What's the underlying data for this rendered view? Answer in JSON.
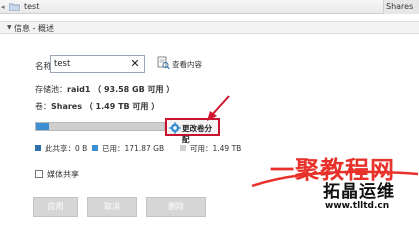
{
  "topbar": {
    "title": "test",
    "right_tab": "Shares",
    "icon": "folder-icon"
  },
  "section": {
    "label": "信息 - 概述"
  },
  "name": {
    "label": "名称：",
    "value": "test",
    "clear_icon": "close-icon",
    "view_link": "查看内容",
    "view_icon": "document-icon"
  },
  "pool": {
    "label": "存储池：",
    "value": "raid1 （ 93.58 GB 可用 ）"
  },
  "volume": {
    "label": "卷：",
    "value": "Shares （ 1.49 TB 可用 ）"
  },
  "usage": {
    "used_fraction": 0.1,
    "bar_color": "#3d8fd3"
  },
  "change_volume": {
    "label": "更改卷分配",
    "icon": "gear-icon",
    "highlight_color": "#c8132e"
  },
  "legend": [
    {
      "label": "此共享：0 B",
      "color": "#2f6fae"
    },
    {
      "label": "已用：171.87 GB",
      "color": "#3d8fd3"
    },
    {
      "label": "可用：1.49 TB",
      "color": "#cfcfcf"
    }
  ],
  "media_share": {
    "label": "媒体共享",
    "checked": false
  },
  "buttons": {
    "apply": "应用",
    "cancel": "取消",
    "delete": "删除"
  },
  "watermark": {
    "line1": "一聚教程网",
    "line2": "拓晶运维",
    "line3": "www.tlltd.cn"
  }
}
